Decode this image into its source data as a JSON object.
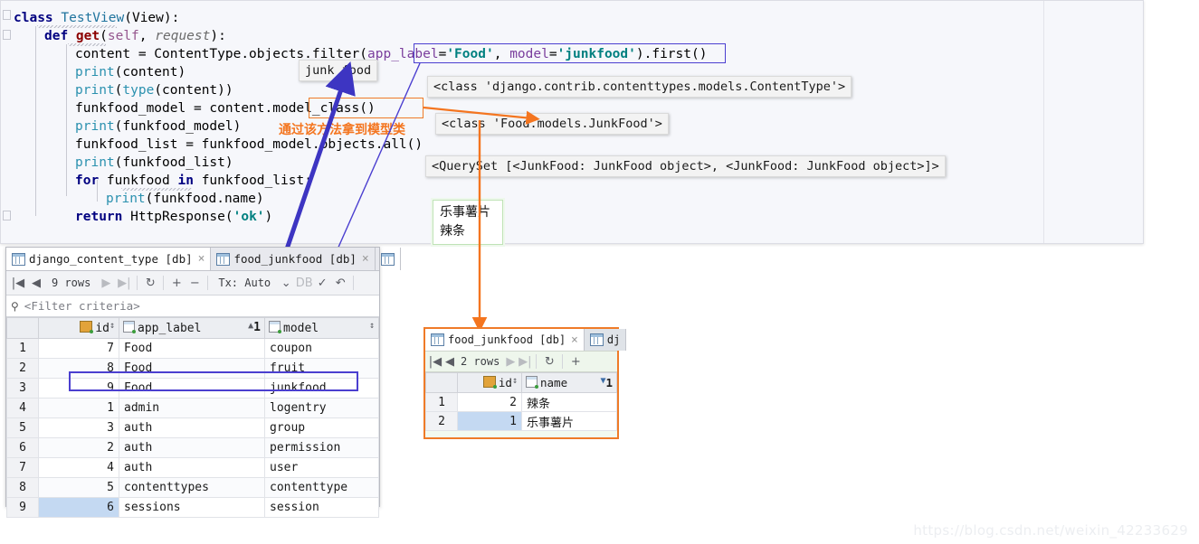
{
  "editor": {
    "lines": [
      {
        "indent": 0,
        "tokens": [
          {
            "t": "class ",
            "c": "kw"
          },
          {
            "t": "TestView",
            "c": "cls"
          },
          {
            "t": "(View):",
            "c": ""
          }
        ]
      },
      {
        "indent": 1,
        "tokens": [
          {
            "t": "def ",
            "c": "kw"
          },
          {
            "t": "get",
            "c": "kwr"
          },
          {
            "t": "(",
            "c": ""
          },
          {
            "t": "self",
            "c": "self"
          },
          {
            "t": ", ",
            "c": ""
          },
          {
            "t": "request",
            "c": "param"
          },
          {
            "t": "):",
            "c": ""
          }
        ]
      },
      {
        "indent": 2,
        "tokens": [
          {
            "t": "content = ContentType.objects.filter(",
            "c": ""
          },
          {
            "t": "app_label",
            "c": "kwarg"
          },
          {
            "t": "=",
            "c": ""
          },
          {
            "t": "'Food'",
            "c": "str"
          },
          {
            "t": ", ",
            "c": ""
          },
          {
            "t": "model",
            "c": "kwarg"
          },
          {
            "t": "=",
            "c": ""
          },
          {
            "t": "'junkfood'",
            "c": "str"
          },
          {
            "t": ").first()",
            "c": ""
          }
        ]
      },
      {
        "indent": 2,
        "tokens": [
          {
            "t": "print",
            "c": "fn"
          },
          {
            "t": "(content)",
            "c": ""
          }
        ]
      },
      {
        "indent": 2,
        "tokens": [
          {
            "t": "print",
            "c": "fn"
          },
          {
            "t": "(",
            "c": ""
          },
          {
            "t": "type",
            "c": "fn"
          },
          {
            "t": "(content))",
            "c": ""
          }
        ]
      },
      {
        "indent": 2,
        "tokens": [
          {
            "t": "funkfood_model = content.model_class()",
            "c": ""
          }
        ]
      },
      {
        "indent": 2,
        "tokens": [
          {
            "t": "print",
            "c": "fn"
          },
          {
            "t": "(funkfood_model)",
            "c": ""
          }
        ]
      },
      {
        "indent": 2,
        "tokens": [
          {
            "t": "funkfood_list = funkfood_model.objects.all()",
            "c": ""
          }
        ]
      },
      {
        "indent": 2,
        "tokens": [
          {
            "t": "print",
            "c": "fn"
          },
          {
            "t": "(funkfood_list)",
            "c": ""
          }
        ]
      },
      {
        "indent": 2,
        "tokens": [
          {
            "t": "for ",
            "c": "kw"
          },
          {
            "t": "funkfood ",
            "c": ""
          },
          {
            "t": "in ",
            "c": "kw"
          },
          {
            "t": "funkfood_list:",
            "c": ""
          }
        ]
      },
      {
        "indent": 3,
        "tokens": [
          {
            "t": "print",
            "c": "fn"
          },
          {
            "t": "(funkfood.name)",
            "c": ""
          }
        ]
      },
      {
        "indent": 2,
        "tokens": [
          {
            "t": "return ",
            "c": "kw"
          },
          {
            "t": "HttpResponse(",
            "c": ""
          },
          {
            "t": "'ok'",
            "c": "str"
          },
          {
            "t": ")",
            "c": ""
          }
        ]
      }
    ]
  },
  "annotations": {
    "tooltip_junk_food": "junk food",
    "out_contenttype": "<class 'django.contrib.contenttypes.models.ContentType'>",
    "out_junkfood_class": "<class 'Food.models.JunkFood'>",
    "out_queryset": "<QuerySet [<JunkFood: JunkFood object>, <JunkFood: JunkFood object>]>",
    "note_model_class_cn": "通过该方法拿到模型类",
    "printed_names": [
      "乐事薯片",
      "辣条"
    ],
    "colors": {
      "blue_arrow": "#3d35c2",
      "orange_arrow": "#f4751f",
      "box_blue": "#4b3fd0",
      "box_orange": "#ef7b28",
      "green_box_border": "#bfe3b6"
    }
  },
  "db_panel_1": {
    "tabs": [
      {
        "label": "django_content_type [db]",
        "active": true,
        "close": "×"
      },
      {
        "label": "food_junkfood [db]",
        "active": false,
        "close": "×"
      },
      {
        "label": "",
        "active": false,
        "close": ""
      }
    ],
    "toolbar": {
      "first": "|◀",
      "prev": "◀",
      "rows": "9 rows",
      "next": "▶",
      "last": "▶|",
      "refresh": "↻",
      "add": "+",
      "remove": "−",
      "tx_label": "Tx: Auto",
      "tx_caret": "⌄",
      "db_upload": "DB",
      "commit": "✓",
      "rollback": "↶"
    },
    "filter_placeholder": "<Filter criteria>",
    "columns": [
      {
        "label": "id",
        "icon": "key-icon",
        "sort": "↕"
      },
      {
        "label": "app_label",
        "icon": "column-icon",
        "sort": "▲",
        "sort_order": "1"
      },
      {
        "label": "model",
        "icon": "column-icon",
        "sort": "↕"
      }
    ],
    "rows": [
      {
        "n": "1",
        "id": "7",
        "app_label": "Food",
        "model": "coupon"
      },
      {
        "n": "2",
        "id": "8",
        "app_label": "Food",
        "model": "fruit"
      },
      {
        "n": "3",
        "id": "9",
        "app_label": "Food",
        "model": "junkfood",
        "highlight": true
      },
      {
        "n": "4",
        "id": "1",
        "app_label": "admin",
        "model": "logentry"
      },
      {
        "n": "5",
        "id": "3",
        "app_label": "auth",
        "model": "group"
      },
      {
        "n": "6",
        "id": "2",
        "app_label": "auth",
        "model": "permission"
      },
      {
        "n": "7",
        "id": "4",
        "app_label": "auth",
        "model": "user"
      },
      {
        "n": "8",
        "id": "5",
        "app_label": "contenttypes",
        "model": "contenttype"
      },
      {
        "n": "9",
        "id": "6",
        "app_label": "sessions",
        "model": "session",
        "selected": true
      }
    ]
  },
  "db_panel_2": {
    "tabs": [
      {
        "label": "food_junkfood [db]",
        "active": true,
        "close": "×"
      },
      {
        "label": "dj",
        "active": false,
        "close": ""
      }
    ],
    "toolbar": {
      "first": "|◀",
      "prev": "◀",
      "rows": "2 rows",
      "next": "▶",
      "last": "▶|",
      "refresh": "↻",
      "add": "+"
    },
    "columns": [
      {
        "label": "id",
        "icon": "key-icon",
        "sort": "↕"
      },
      {
        "label": "name",
        "icon": "column-icon",
        "sort": "▼",
        "sort_order": "1"
      }
    ],
    "rows": [
      {
        "n": "1",
        "id": "2",
        "name": "辣条"
      },
      {
        "n": "2",
        "id": "1",
        "name": "乐事薯片",
        "selected": true
      }
    ]
  },
  "watermark": "https://blog.csdn.net/weixin_42233629"
}
